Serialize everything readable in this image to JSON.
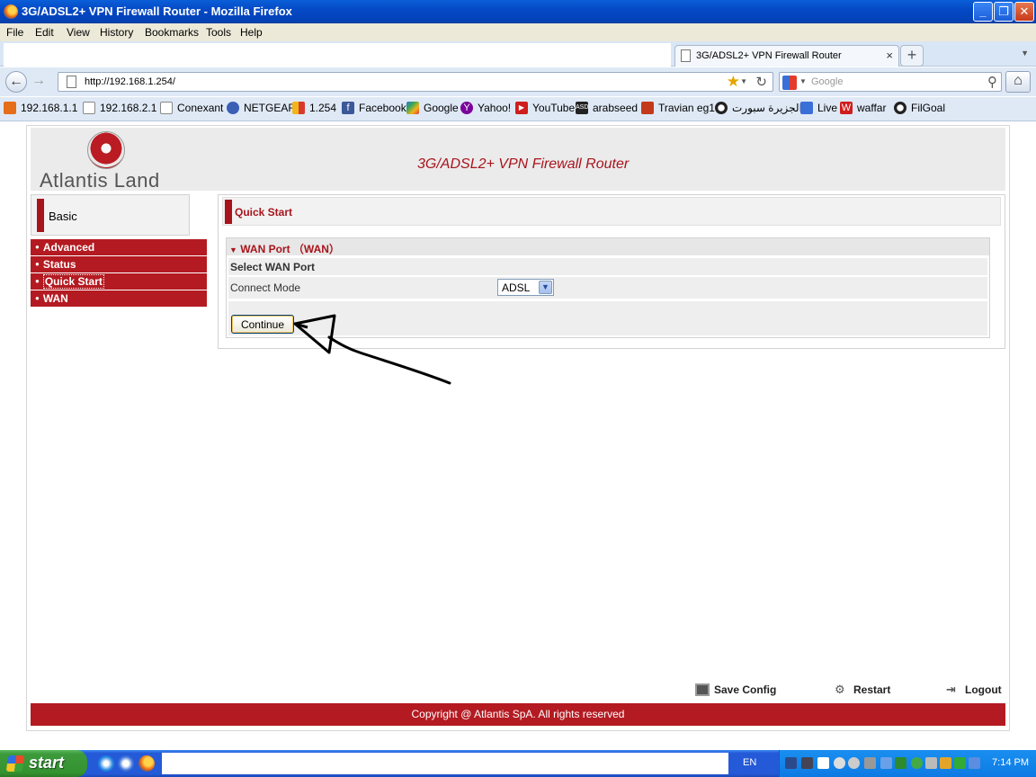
{
  "window": {
    "title": "3G/ADSL2+ VPN Firewall Router - Mozilla Firefox",
    "minimize": "_",
    "maximize": "❐",
    "close": "✕"
  },
  "menu": [
    "File",
    "Edit",
    "View",
    "History",
    "Bookmarks",
    "Tools",
    "Help"
  ],
  "tab": {
    "title": "3G/ADSL2+ VPN Firewall Router",
    "close": "×",
    "new": "+"
  },
  "nav": {
    "url": "http://192.168.1.254/",
    "search_placeholder": "Google"
  },
  "bookmarks": [
    {
      "label": "192.168.1.1",
      "icon": "firefox-icon"
    },
    {
      "label": "192.168.2.1",
      "icon": "page-icon"
    },
    {
      "label": "Conexant",
      "icon": "page-icon"
    },
    {
      "label": "NETGEAR",
      "icon": "netgear-icon"
    },
    {
      "label": "1.254",
      "icon": "colorblocks-icon"
    },
    {
      "label": "Facebook",
      "icon": "facebook-icon"
    },
    {
      "label": "Google",
      "icon": "google-icon"
    },
    {
      "label": "Yahoo!",
      "icon": "yahoo-icon"
    },
    {
      "label": "YouTube",
      "icon": "youtube-icon"
    },
    {
      "label": "arabseed",
      "icon": "asd-icon"
    },
    {
      "label": "Travian eg1",
      "icon": "travian-icon"
    },
    {
      "label": "الجزيرة سبورت",
      "icon": "ball-icon"
    },
    {
      "label": "Live",
      "icon": "live-icon"
    },
    {
      "label": "waffar",
      "icon": "waffar-icon"
    },
    {
      "label": "FilGoal",
      "icon": "ball-icon"
    }
  ],
  "router": {
    "brand": "Atlantis Land",
    "title": "3G/ADSL2+ VPN Firewall Router",
    "basic": "Basic",
    "menu": [
      "Advanced",
      "Status",
      "Quick Start",
      "WAN"
    ],
    "active_menu": "Quick Start",
    "quick_start": "Quick Start",
    "wan_section": "WAN Port  （WAN）",
    "select_label": "Select WAN Port",
    "connect_mode_label": "Connect Mode",
    "connect_mode_value": "ADSL",
    "continue_button": "Continue",
    "save_config": "Save Config",
    "restart": "Restart",
    "logout": "Logout",
    "copyright": "Copyright @ Atlantis SpA. All rights reserved"
  },
  "taskbar": {
    "start": "start",
    "language": "EN",
    "clock": "7:14 PM"
  },
  "colors": {
    "brand_red": "#a8141c",
    "menu_red": "#b41a21",
    "xp_blue": "#245ad8",
    "start_green": "#3c9a3c"
  }
}
